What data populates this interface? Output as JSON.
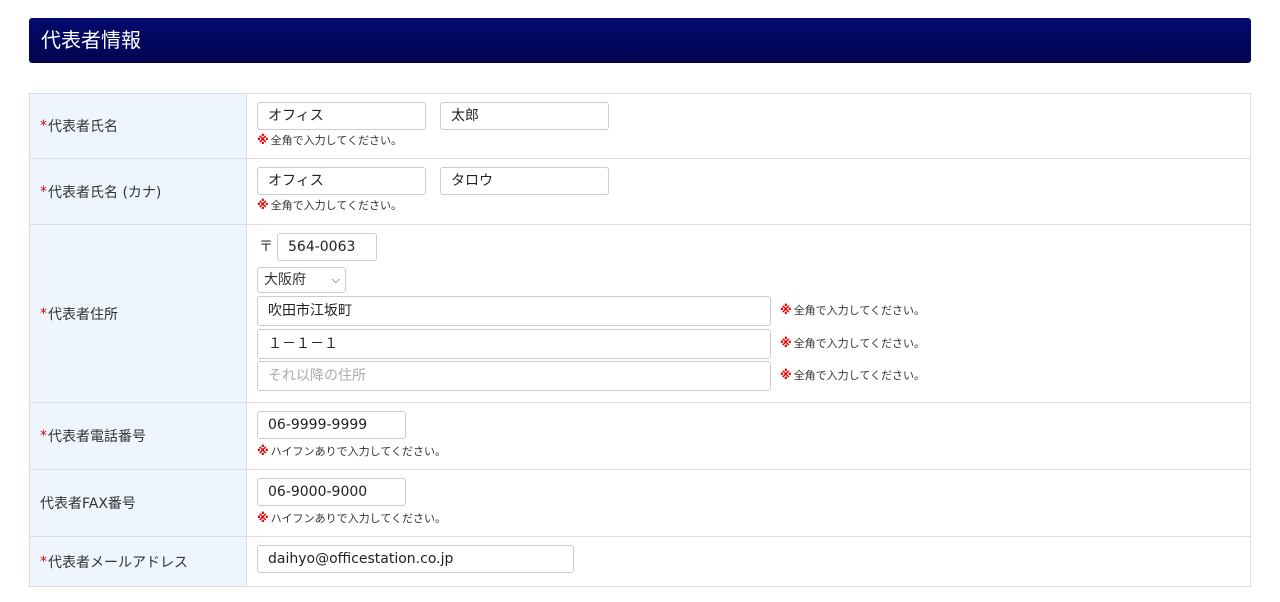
{
  "section": {
    "title": "代表者情報"
  },
  "required_mark": "*",
  "note_mark": "※",
  "rows": {
    "name": {
      "label": "代表者氏名",
      "last": "オフィス",
      "first": "太郎",
      "note": "全角で入力してください。"
    },
    "kana": {
      "label": "代表者氏名 (カナ)",
      "last": "オフィス",
      "first": "タロウ",
      "note": "全角で入力してください。"
    },
    "address": {
      "label": "代表者住所",
      "zip_symbol": "〒",
      "zip": "564-0063",
      "prefecture": "大阪府",
      "line1": "吹田市江坂町",
      "line2": "１－１－１",
      "line3_placeholder": "それ以降の住所",
      "note": "全角で入力してください。"
    },
    "phone": {
      "label": "代表者電話番号",
      "value": "06-9999-9999",
      "note": "ハイフンありで入力してください。"
    },
    "fax": {
      "label": "代表者FAX番号",
      "value": "06-9000-9000",
      "note": "ハイフンありで入力してください。"
    },
    "email": {
      "label": "代表者メールアドレス",
      "value": "daihyo@officestation.co.jp"
    }
  }
}
